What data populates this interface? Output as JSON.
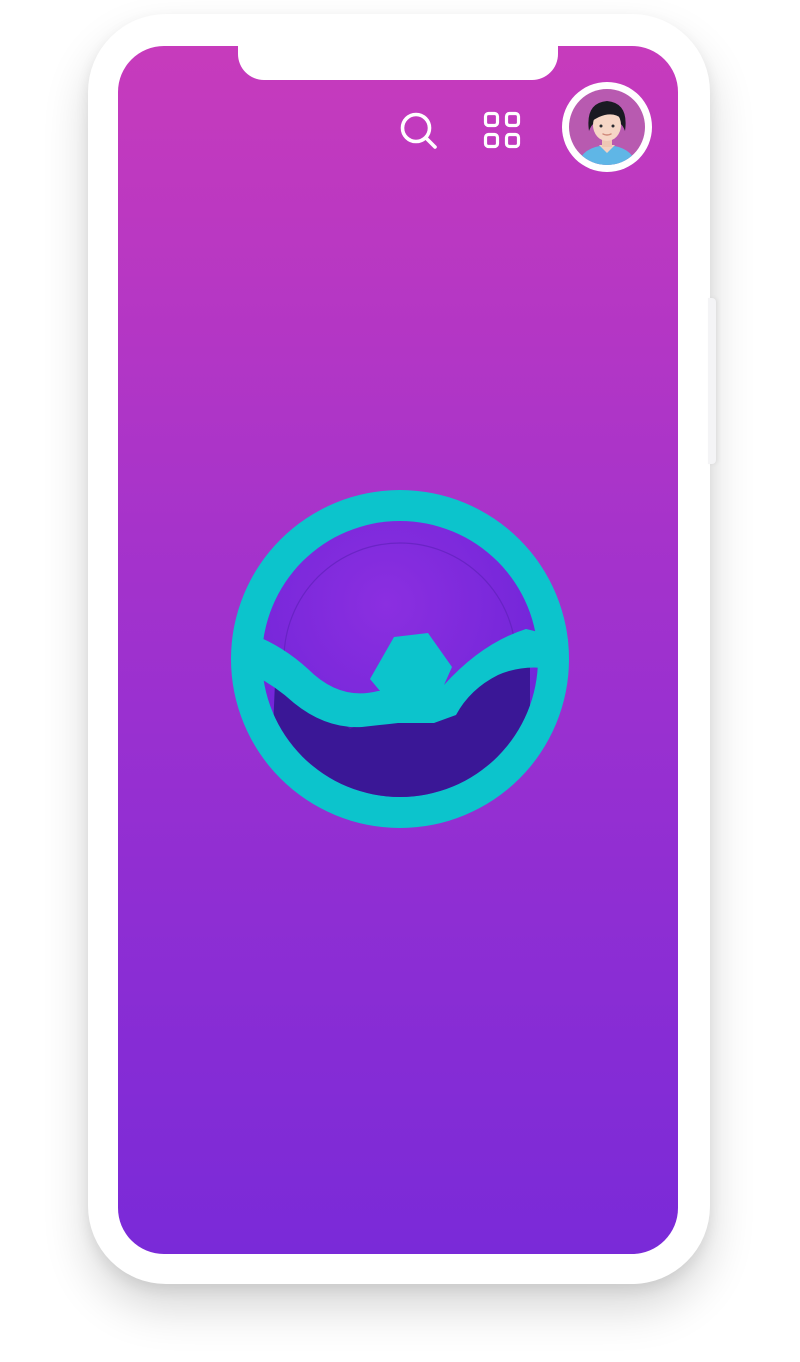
{
  "screen": {
    "background_gradient": [
      "#c73bbc",
      "#9a30d0",
      "#7a2ad8"
    ]
  },
  "toolbar": {
    "search_icon": "search-icon",
    "apps_icon": "grid-icon",
    "profile_icon": "user-avatar",
    "icon_color": "#ffffff"
  },
  "logo": {
    "icon": "app-logo",
    "ring_color": "#0cc4cc",
    "inner_color": "#7a28db",
    "core_color": "#3a1796"
  }
}
